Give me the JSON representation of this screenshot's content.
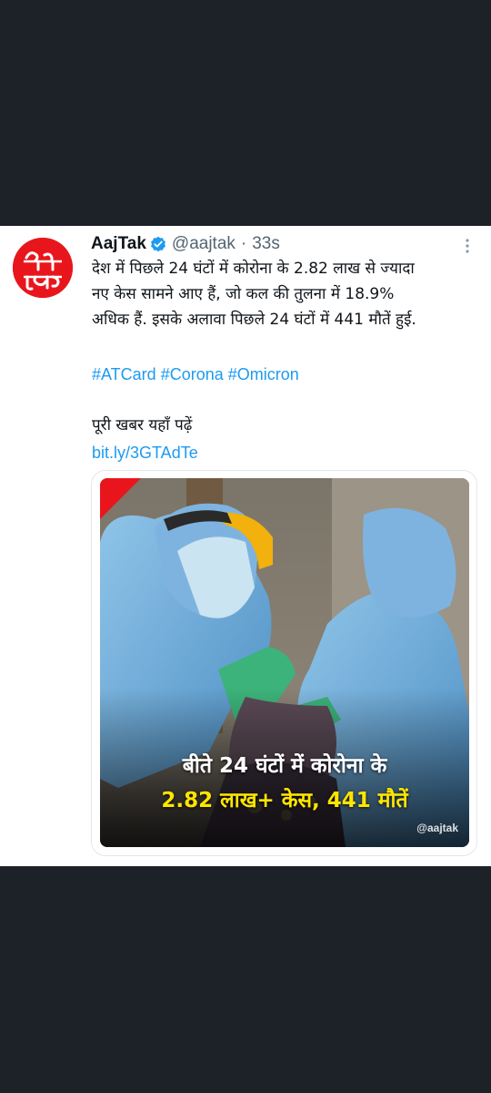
{
  "tweet": {
    "author_name": "AajTak",
    "handle": "@aajtak",
    "separator": "·",
    "time": "33s",
    "body_lines": [
      "देश में पिछले 24 घंटों में कोरोना के 2.82 लाख से ज्यादा",
      "नए केस सामने आए हैं, जो कल की तुलना में 18.9%",
      "अधिक हैं. इसके अलावा पिछले 24 घंटों में  441 मौतें हुई."
    ],
    "hashtags": [
      "#ATCard",
      "#Corona",
      "#Omicron"
    ],
    "read_more": "पूरी खबर यहाँ पढ़ें",
    "link": "bit.ly/3GTAdTe",
    "media": {
      "caption_line_1": "बीते 24 घंटों में कोरोना के",
      "caption_line_2": "2.82 लाख+ केस, 441 मौतें",
      "watermark": "@aajtak"
    }
  },
  "icons": {
    "avatar": "aajtak-logo",
    "verified": "verified-badge-icon",
    "more": "more-options-icon"
  },
  "colors": {
    "page_background": "#1d2128",
    "card_background": "#ffffff",
    "accent": "#1d9bf0",
    "brand_red": "#e8161c",
    "text_primary": "#0f1419",
    "text_secondary": "#536471",
    "caption_highlight": "#ffe500"
  }
}
